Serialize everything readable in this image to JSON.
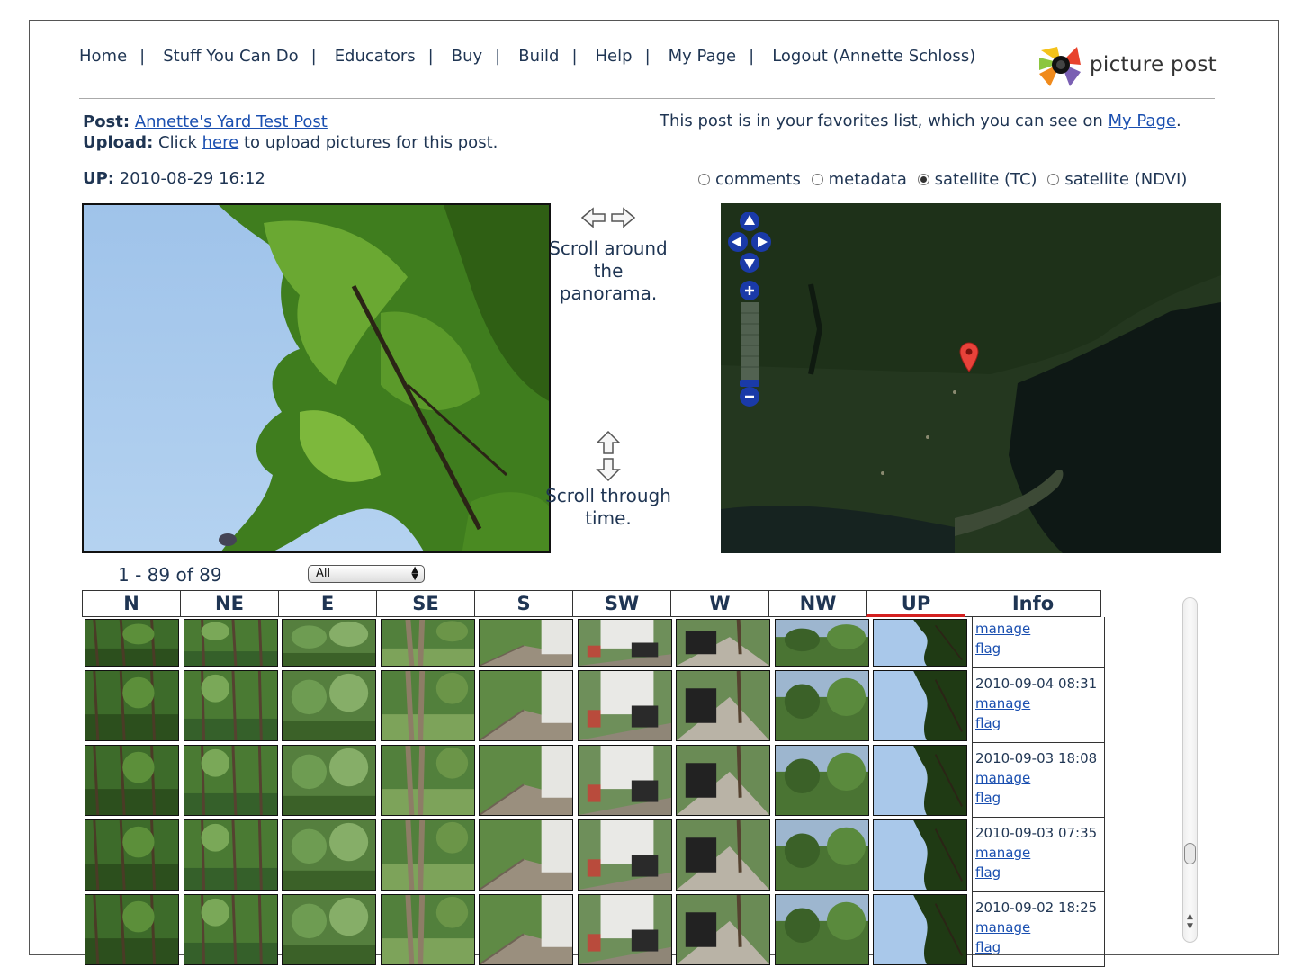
{
  "nav": {
    "items": [
      "Home",
      "Stuff You Can Do",
      "Educators",
      "Buy",
      "Build",
      "Help",
      "My Page",
      "Logout (Annette Schloss)"
    ],
    "separator": "|"
  },
  "logo": {
    "text": "picture post"
  },
  "post": {
    "post_label": "Post:",
    "post_name": "Annette's Yard Test Post",
    "upload_label": "Upload:",
    "upload_pre": "Click",
    "upload_link": "here",
    "upload_post": "to upload pictures for this post.",
    "favorites_text": "This post is in your favorites list, which you can see on",
    "favorites_link": "My Page",
    "favorites_end": "."
  },
  "current": {
    "dir_label": "UP:",
    "timestamp": "2010-08-29 16:12"
  },
  "view_options": [
    {
      "label": "comments",
      "checked": false
    },
    {
      "label": "metadata",
      "checked": false
    },
    {
      "label": "satellite (TC)",
      "checked": true
    },
    {
      "label": "satellite (NDVI)",
      "checked": false
    }
  ],
  "hints": {
    "scroll_around": "Scroll around the panorama.",
    "scroll_time": "Scroll through time."
  },
  "pagination": {
    "range": "1 - 89 of 89",
    "filter_selected": "All"
  },
  "grid": {
    "columns": [
      "N",
      "NE",
      "E",
      "SE",
      "S",
      "SW",
      "W",
      "NW",
      "UP",
      "Info"
    ],
    "rows": [
      {
        "date": "",
        "manage": "manage",
        "flag": "flag"
      },
      {
        "date": "2010-09-04 08:31",
        "manage": "manage",
        "flag": "flag"
      },
      {
        "date": "2010-09-03 18:08",
        "manage": "manage",
        "flag": "flag"
      },
      {
        "date": "2010-09-03 07:35",
        "manage": "manage",
        "flag": "flag"
      },
      {
        "date": "2010-09-02 18:25",
        "manage": "manage",
        "flag": "flag"
      }
    ]
  },
  "colors": {
    "accent": "#1a4fb0",
    "up_marker": "#d32020",
    "nav_text": "#1f3553"
  }
}
